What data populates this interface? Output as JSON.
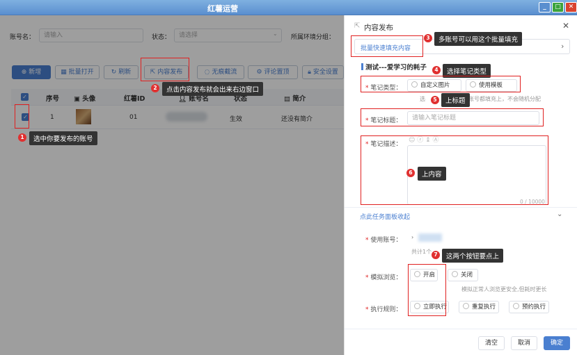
{
  "window": {
    "title": "红薯运营",
    "min": "_",
    "max": "□",
    "close": "✕"
  },
  "filters": {
    "account_label": "账号名：",
    "account_placeholder": "请输入",
    "status_label": "状态：",
    "status_placeholder": "请选择",
    "env_label": "所属环境分组："
  },
  "toolbar": {
    "add": "新增",
    "batch_open": "批量打开",
    "refresh": "刷新",
    "publish": "内容发布",
    "traceless": "无痕截流",
    "comment_top": "评论置顶",
    "security": "安全设置"
  },
  "table": {
    "headers": {
      "seq": "序号",
      "avatar": "头像",
      "redbook_id": "红薯ID",
      "account": "账号名",
      "status": "状态",
      "intro": "简介"
    },
    "row": {
      "seq": "1",
      "redbook_id": "01",
      "status": "生效",
      "intro": "还没有简介"
    }
  },
  "annotations": {
    "a1": {
      "num": "1",
      "text": "选中你要发布的账号"
    },
    "a2": {
      "num": "2",
      "text": "点击内容发布就会出来右边窗口"
    },
    "a3": {
      "num": "3",
      "text": "多账号可以用这个批量填充"
    },
    "a4": {
      "num": "4",
      "text": "选择笔记类型"
    },
    "a5": {
      "num": "5",
      "text": "上标题"
    },
    "a6": {
      "num": "6",
      "text": "上内容"
    },
    "a7": {
      "num": "7",
      "text": "这两个按钮要点上"
    }
  },
  "panel": {
    "title": "内容发布",
    "batch_fill": "批量快速填充内容",
    "account_heading": "测试---爱学习的耗子",
    "note_type_label": "笔记类型：",
    "note_type_options": [
      "自定义图片",
      "使用模板"
    ],
    "note_type_hint_a": "选",
    "note_type_hint_b": "账号都填充上，不会随机分配",
    "title_label": "笔记标题：",
    "title_placeholder": "请输入笔记标题",
    "desc_label": "笔记描述：",
    "desc_counter": "0 / 10000",
    "collapse_link": "点此任务面板收起",
    "use_account_label": "使用账号：",
    "use_account_count": "共计1个",
    "browse_label": "模拟浏览：",
    "browse_options": [
      "开启",
      "关闭"
    ],
    "browse_hint": "模拟正常人浏览更安全,但耗时更长",
    "rule_label": "执行规则：",
    "rule_options": [
      "立即执行",
      "重复执行",
      "预约执行"
    ],
    "btn_clear": "清空",
    "btn_cancel": "取消",
    "btn_confirm": "确定"
  },
  "colors": {
    "accent": "#4a7fd0",
    "annotation_red": "#e02020"
  }
}
